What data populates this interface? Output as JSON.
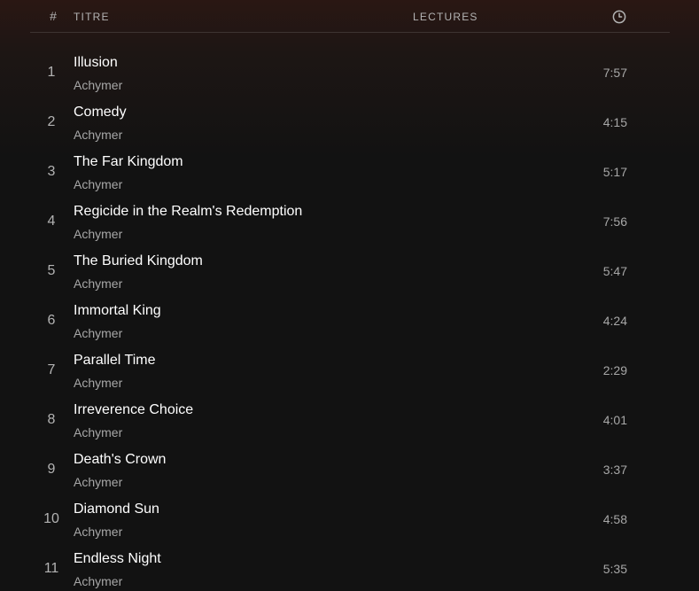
{
  "header": {
    "number": "#",
    "title": "TITRE",
    "plays": "LECTURES",
    "duration_icon": "clock-icon"
  },
  "tracks": [
    {
      "number": "1",
      "title": "Illusion",
      "artist": "Achymer",
      "duration": "7:57"
    },
    {
      "number": "2",
      "title": "Comedy",
      "artist": "Achymer",
      "duration": "4:15"
    },
    {
      "number": "3",
      "title": "The Far Kingdom",
      "artist": "Achymer",
      "duration": "5:17"
    },
    {
      "number": "4",
      "title": "Regicide in the Realm's Redemption",
      "artist": "Achymer",
      "duration": "7:56"
    },
    {
      "number": "5",
      "title": "The Buried Kingdom",
      "artist": "Achymer",
      "duration": "5:47"
    },
    {
      "number": "6",
      "title": "Immortal King",
      "artist": "Achymer",
      "duration": "4:24"
    },
    {
      "number": "7",
      "title": "Parallel Time",
      "artist": "Achymer",
      "duration": "2:29"
    },
    {
      "number": "8",
      "title": "Irreverence Choice",
      "artist": "Achymer",
      "duration": "4:01"
    },
    {
      "number": "9",
      "title": "Death's Crown",
      "artist": "Achymer",
      "duration": "3:37"
    },
    {
      "number": "10",
      "title": "Diamond Sun",
      "artist": "Achymer",
      "duration": "4:58"
    },
    {
      "number": "11",
      "title": "Endless Night",
      "artist": "Achymer",
      "duration": "5:35"
    }
  ]
}
